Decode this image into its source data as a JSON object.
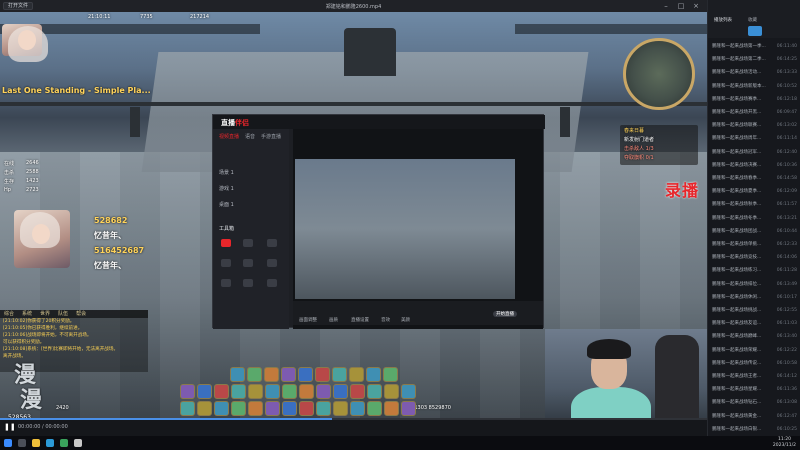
{
  "player": {
    "open_button": "打开文件",
    "file_title": "郑建铭和鹏隆2600.mp4",
    "current_time": "00:00:00 / 00:00:00",
    "window_controls": [
      "minimize-icon",
      "maximize-icon",
      "close-icon"
    ]
  },
  "game": {
    "top_left_time": "21:10:11",
    "top_left_info": "7735",
    "kill_count": "217214",
    "banner": "Last One Standing - Simple Pla...",
    "stats": [
      {
        "label": "在线",
        "value": "2646"
      },
      {
        "label": "击杀",
        "value": "2588"
      },
      {
        "label": "生存",
        "value": "1423"
      },
      {
        "label": "Hp",
        "value": "2723"
      }
    ],
    "gift_lines": [
      "528682",
      "忆昔年、",
      "516452687",
      "忆昔年、"
    ],
    "chat_tabs": [
      "综合",
      "系统",
      "世界",
      "队伍",
      "帮会"
    ],
    "chat_lines": [
      "[21:10:02]你获得了20积分奖励。",
      "[21:10:05]你已获得胜利，继续前进。",
      "[21:10:06]战场即将开始，不可离开战场。",
      "可以获得积分奖励。",
      "[21:10:08]系统：[世界]比赛即将开始，无法离开战场。",
      "离开战场。"
    ],
    "quest_lines": [
      "春来日暮",
      "新发射门道者",
      "击杀敌人 1/3",
      "夺取旗帜 0/1"
    ],
    "bottom_coords": "261303 8529870",
    "bottom_left": "528563",
    "luobo": "录播",
    "watermark_1": "漫",
    "watermark_2": "漫",
    "score_line": "2420"
  },
  "liveapp": {
    "logo_main": "直播",
    "logo_red": "伴侣",
    "tabs": [
      "视频直播",
      "语音",
      "手游直播"
    ],
    "rows": [
      "场景 1",
      "游戏 1",
      "桌面 1",
      "工具箱"
    ],
    "toolbar": [
      "画面调整",
      "画质",
      "直播设置",
      "音效",
      "美颜",
      "开始直播"
    ]
  },
  "playlist": {
    "tabs": [
      "播放列表",
      "收藏"
    ],
    "items": [
      {
        "title": "鹏隆和一起来战场第一季...",
        "dur": "06:11:40"
      },
      {
        "title": "鹏隆和一起来战场第二季...",
        "dur": "06:14:25"
      },
      {
        "title": "鹏隆和一起来战场活动...",
        "dur": "06:13:33"
      },
      {
        "title": "鹏隆和一起来战场新版本...",
        "dur": "06:10:52"
      },
      {
        "title": "鹏隆和一起来战场赛季...",
        "dur": "06:12:18"
      },
      {
        "title": "鹏隆和一起来战场开黑...",
        "dur": "06:09:47"
      },
      {
        "title": "鹏隆和一起来战场联赛...",
        "dur": "06:13:02"
      },
      {
        "title": "鹏隆和一起来战场周年...",
        "dur": "06:11:14"
      },
      {
        "title": "鹏隆和一起来战场冠军...",
        "dur": "06:12:40"
      },
      {
        "title": "鹏隆和一起来战场决赛...",
        "dur": "06:10:36"
      },
      {
        "title": "鹏隆和一起来战场春季...",
        "dur": "06:14:58"
      },
      {
        "title": "鹏隆和一起来战场夏季...",
        "dur": "06:12:09"
      },
      {
        "title": "鹏隆和一起来战场秋季...",
        "dur": "06:11:57"
      },
      {
        "title": "鹏隆和一起来战场冬季...",
        "dur": "06:13:21"
      },
      {
        "title": "鹏隆和一起来战场团战...",
        "dur": "06:10:44"
      },
      {
        "title": "鹏隆和一起来战场单挑...",
        "dur": "06:12:33"
      },
      {
        "title": "鹏隆和一起来战场竞技...",
        "dur": "06:14:06"
      },
      {
        "title": "鹏隆和一起来战场练习...",
        "dur": "06:11:28"
      },
      {
        "title": "鹏隆和一起来战场排位...",
        "dur": "06:13:49"
      },
      {
        "title": "鹏隆和一起来战场休闲...",
        "dur": "06:10:17"
      },
      {
        "title": "鹏隆和一起来战场挑战...",
        "dur": "06:12:55"
      },
      {
        "title": "鹏隆和一起来战场友谊...",
        "dur": "06:11:03"
      },
      {
        "title": "鹏隆和一起来战场巅峰...",
        "dur": "06:13:40"
      },
      {
        "title": "鹏隆和一起来战场荣耀...",
        "dur": "06:12:22"
      },
      {
        "title": "鹏隆和一起来战场传说...",
        "dur": "06:10:58"
      },
      {
        "title": "鹏隆和一起来战场王者...",
        "dur": "06:14:12"
      },
      {
        "title": "鹏隆和一起来战场星耀...",
        "dur": "06:11:36"
      },
      {
        "title": "鹏隆和一起来战场钻石...",
        "dur": "06:13:08"
      },
      {
        "title": "鹏隆和一起来战场黄金...",
        "dur": "06:12:47"
      },
      {
        "title": "鹏隆和一起来战场白银...",
        "dur": "06:10:25"
      }
    ]
  },
  "taskbar": {
    "time": "11:20",
    "date": "2023/11/2"
  },
  "colors": {
    "accent": "#4a8fe7",
    "record_red": "#e8262b",
    "chat_gold": "#f6ce54"
  }
}
